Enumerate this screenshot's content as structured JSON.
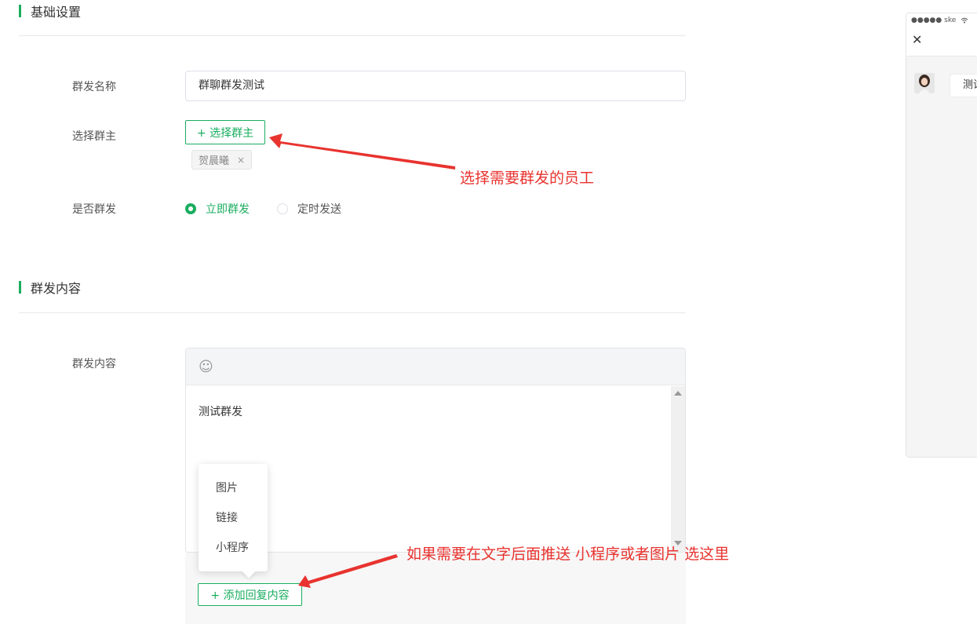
{
  "basic_section": {
    "title": "基础设置"
  },
  "form": {
    "name_label": "群发名称",
    "name_value": "群聊群发测试",
    "owner_label": "选择群主",
    "owner_button": "+ 选择群主",
    "owner_tag": "贺晨曦",
    "tag_close": "×",
    "send_label": "是否群发",
    "send_options": [
      "立即群发",
      "定时发送"
    ]
  },
  "content_section": {
    "title": "群发内容"
  },
  "content": {
    "label": "群发内容",
    "emoji_icon": "☺",
    "text": "测试群发",
    "popup_items": [
      "图片",
      "链接",
      "小程序"
    ],
    "add_reply_button": "+ 添加回复内容"
  },
  "annotations": {
    "select_owner": "选择需要群发的员工",
    "add_reply": "如果需要在文字后面推送 小程序或者图片 选这里"
  },
  "phone_preview": {
    "status": "●●●●● ske",
    "close_icon": "✕",
    "message": "测试"
  },
  "colors": {
    "accent": "#1aad5f",
    "annotation": "#e8332f"
  }
}
